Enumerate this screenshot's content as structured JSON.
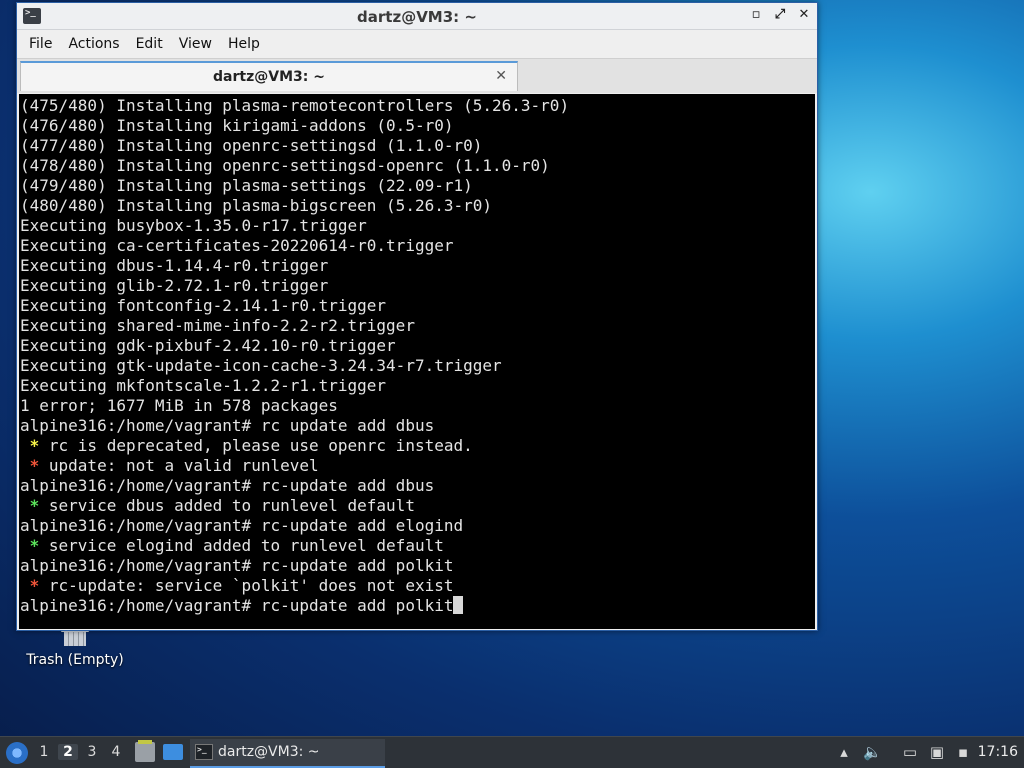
{
  "desktop": {
    "trash_label": "Trash (Empty)"
  },
  "window": {
    "title": "dartz@VM3: ~",
    "controls": {
      "minimize": "▫",
      "maximize": "⤢",
      "close": "✕"
    },
    "menu": [
      "File",
      "Actions",
      "Edit",
      "View",
      "Help"
    ],
    "tab": {
      "label": "dartz@VM3: ~",
      "close": "✕"
    }
  },
  "terminal": {
    "lines": [
      {
        "bullet": "",
        "text": "(475/480) Installing plasma-remotecontrollers (5.26.3-r0)"
      },
      {
        "bullet": "",
        "text": "(476/480) Installing kirigami-addons (0.5-r0)"
      },
      {
        "bullet": "",
        "text": "(477/480) Installing openrc-settingsd (1.1.0-r0)"
      },
      {
        "bullet": "",
        "text": "(478/480) Installing openrc-settingsd-openrc (1.1.0-r0)"
      },
      {
        "bullet": "",
        "text": "(479/480) Installing plasma-settings (22.09-r1)"
      },
      {
        "bullet": "",
        "text": "(480/480) Installing plasma-bigscreen (5.26.3-r0)"
      },
      {
        "bullet": "",
        "text": "Executing busybox-1.35.0-r17.trigger"
      },
      {
        "bullet": "",
        "text": "Executing ca-certificates-20220614-r0.trigger"
      },
      {
        "bullet": "",
        "text": "Executing dbus-1.14.4-r0.trigger"
      },
      {
        "bullet": "",
        "text": "Executing glib-2.72.1-r0.trigger"
      },
      {
        "bullet": "",
        "text": "Executing fontconfig-2.14.1-r0.trigger"
      },
      {
        "bullet": "",
        "text": "Executing shared-mime-info-2.2-r2.trigger"
      },
      {
        "bullet": "",
        "text": "Executing gdk-pixbuf-2.42.10-r0.trigger"
      },
      {
        "bullet": "",
        "text": "Executing gtk-update-icon-cache-3.24.34-r7.trigger"
      },
      {
        "bullet": "",
        "text": "Executing mkfontscale-1.2.2-r1.trigger"
      },
      {
        "bullet": "",
        "text": "1 error; 1677 MiB in 578 packages"
      },
      {
        "bullet": "",
        "text": "alpine316:/home/vagrant# rc update add dbus"
      },
      {
        "bullet": "yellow",
        "text": " rc is deprecated, please use openrc instead."
      },
      {
        "bullet": "red",
        "text": " update: not a valid runlevel"
      },
      {
        "bullet": "",
        "text": "alpine316:/home/vagrant# rc-update add dbus"
      },
      {
        "bullet": "green",
        "text": " service dbus added to runlevel default"
      },
      {
        "bullet": "",
        "text": "alpine316:/home/vagrant# rc-update add elogind"
      },
      {
        "bullet": "green",
        "text": " service elogind added to runlevel default"
      },
      {
        "bullet": "",
        "text": "alpine316:/home/vagrant# rc-update add polkit"
      },
      {
        "bullet": "red",
        "text": " rc-update: service `polkit' does not exist"
      },
      {
        "bullet": "",
        "text": "alpine316:/home/vagrant# rc-update add polkit",
        "cursor": true
      }
    ],
    "bullet_char": " *",
    "colors": {
      "background": "#000000",
      "foreground": "#e4e4e4",
      "yellow": "#f7f44a",
      "green": "#5ce35c",
      "red": "#f0553a"
    }
  },
  "taskbar": {
    "workspaces": [
      "1",
      "2",
      "3",
      "4"
    ],
    "active_workspace": "2",
    "task_label": "dartz@VM3: ~",
    "clock": "17:16",
    "accent": "#5b9de6"
  }
}
